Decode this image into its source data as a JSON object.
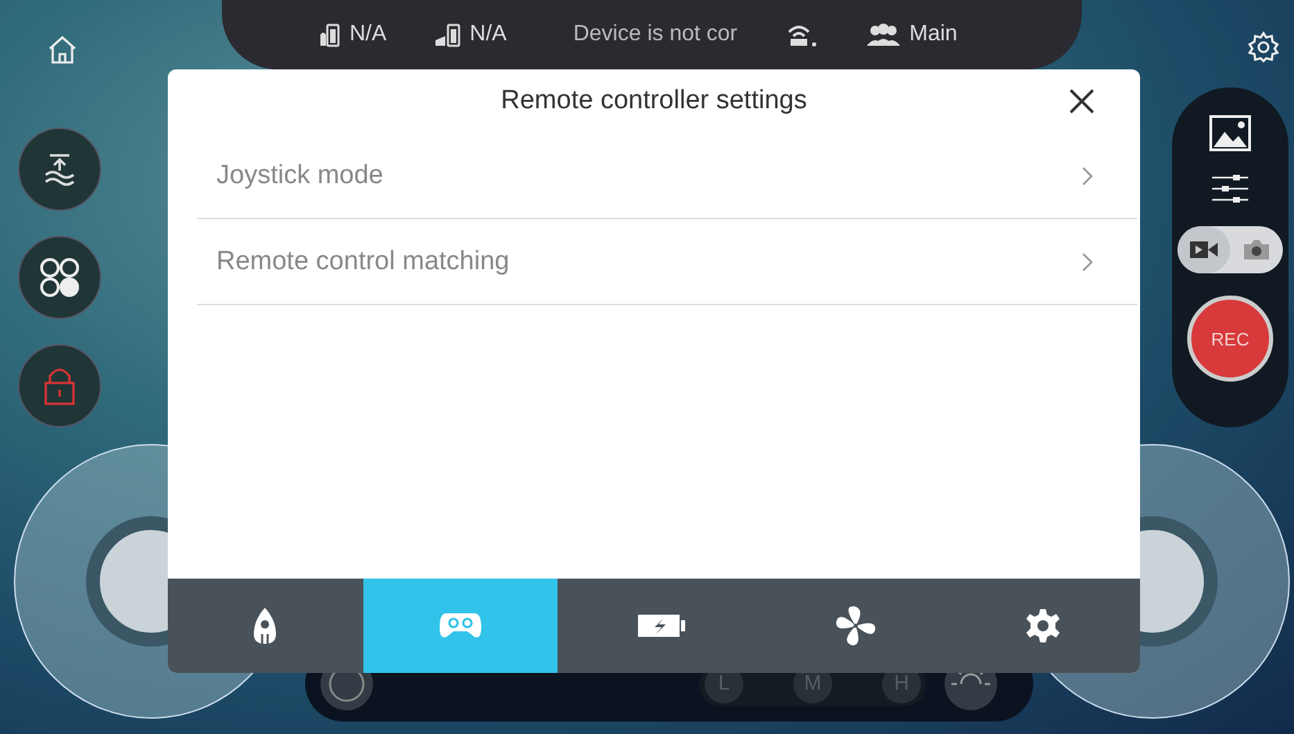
{
  "status_bar": {
    "left_battery": "N/A",
    "right_battery": "N/A",
    "connection": "Device is not cor",
    "role": "Main"
  },
  "camera": {
    "modes": [
      {
        "kind": "video",
        "selected": true
      },
      {
        "kind": "photo",
        "selected": false
      }
    ],
    "record_label": "REC"
  },
  "speed_levels": [
    {
      "label": "L",
      "selected": false
    },
    {
      "label": "M",
      "selected": false
    },
    {
      "label": "H",
      "selected": false
    }
  ],
  "dialog": {
    "title": "Remote controller settings",
    "items": [
      {
        "label": "Joystick mode"
      },
      {
        "label": "Remote control matching"
      }
    ],
    "tabs": [
      {
        "kind": "drone",
        "selected": false
      },
      {
        "kind": "gamepad",
        "selected": true
      },
      {
        "kind": "battery",
        "selected": false
      },
      {
        "kind": "fan",
        "selected": false
      },
      {
        "kind": "gear",
        "selected": false
      }
    ]
  }
}
